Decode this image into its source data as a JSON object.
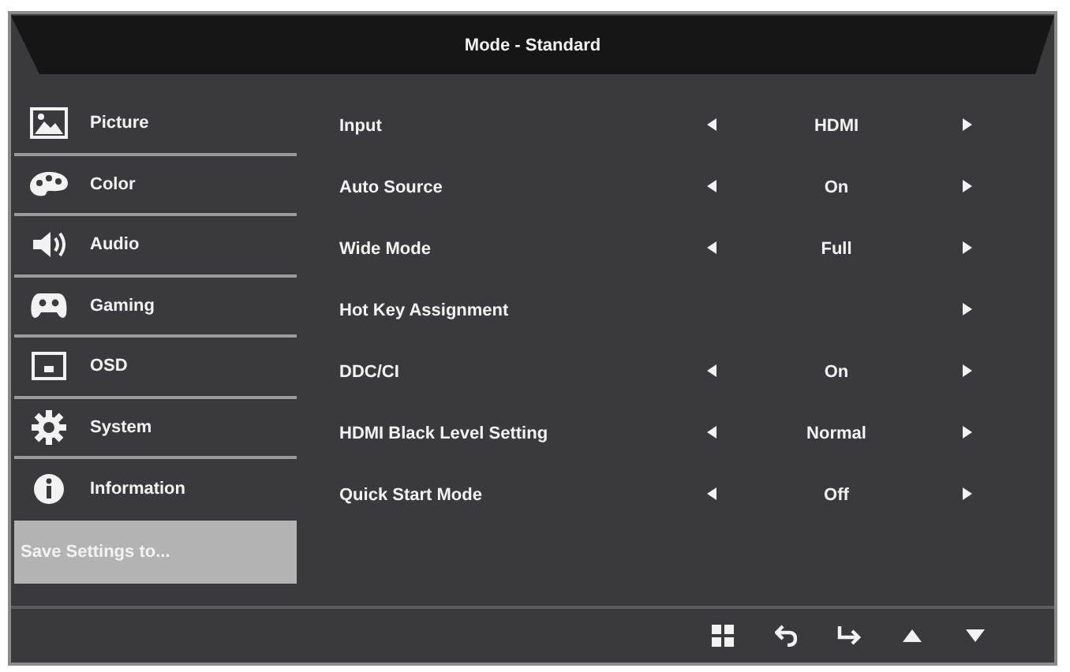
{
  "header": {
    "title": "Mode - Standard"
  },
  "sidebar": {
    "items": [
      {
        "label": "Picture",
        "kind": "category",
        "selected": false
      },
      {
        "label": "Color",
        "kind": "category",
        "selected": false
      },
      {
        "label": "Audio",
        "kind": "category",
        "selected": false
      },
      {
        "label": "Gaming",
        "kind": "category",
        "selected": false
      },
      {
        "label": "OSD",
        "kind": "category",
        "selected": false
      },
      {
        "label": "System",
        "kind": "category",
        "selected": false
      },
      {
        "label": "Information",
        "kind": "category",
        "selected": false
      },
      {
        "label": "Save Settings to...",
        "kind": "action",
        "selected": true
      }
    ]
  },
  "settings": [
    {
      "label": "Input",
      "kind": "option",
      "value": "HDMI"
    },
    {
      "label": "Auto Source",
      "kind": "option",
      "value": "On"
    },
    {
      "label": "Wide Mode",
      "kind": "option",
      "value": "Full"
    },
    {
      "label": "Hot Key Assignment",
      "kind": "submenu"
    },
    {
      "label": "DDC/CI",
      "kind": "option",
      "value": "On"
    },
    {
      "label": "HDMI Black Level Setting",
      "kind": "option",
      "value": "Normal"
    },
    {
      "label": "Quick Start Mode",
      "kind": "option",
      "value": "Off"
    }
  ]
}
